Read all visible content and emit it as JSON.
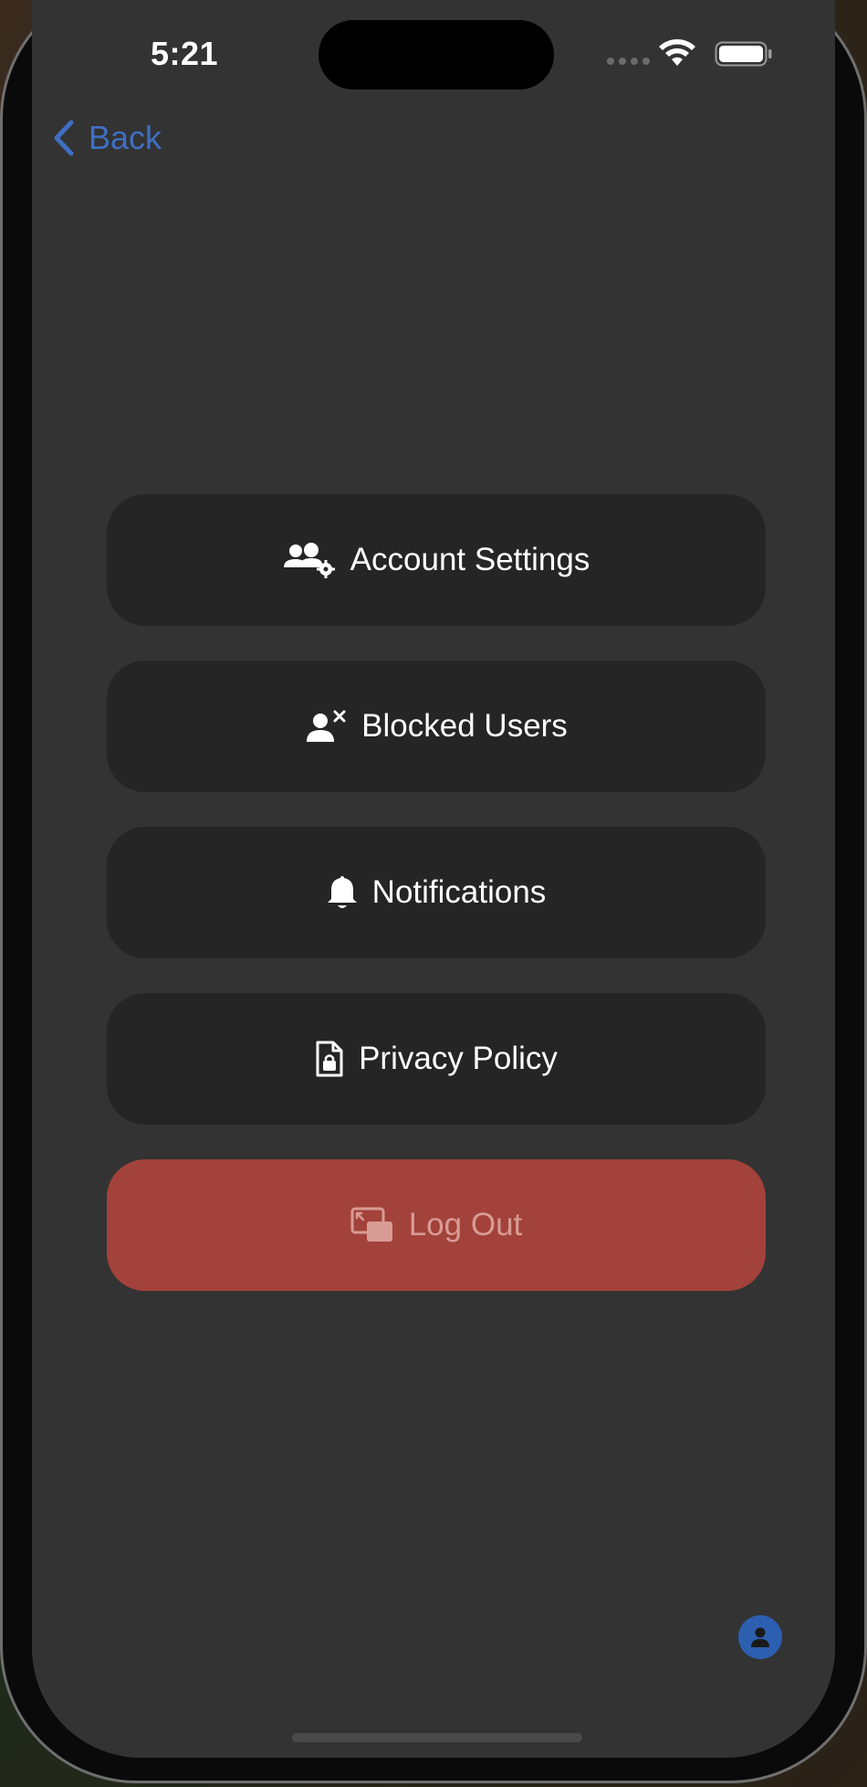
{
  "status_bar": {
    "time": "5:21",
    "icons": [
      "signal-icon",
      "wifi-icon",
      "battery-icon"
    ]
  },
  "nav": {
    "back_label": "Back",
    "back_icon": "chevron-left-icon"
  },
  "menu": {
    "items": [
      {
        "label": "Account Settings",
        "icon": "users-gear-icon"
      },
      {
        "label": "Blocked Users",
        "icon": "user-x-icon"
      },
      {
        "label": "Notifications",
        "icon": "bell-icon"
      },
      {
        "label": "Privacy Policy",
        "icon": "document-lock-icon"
      },
      {
        "label": "Log Out",
        "icon": "logout-screens-icon"
      }
    ]
  },
  "floating": {
    "profile_icon": "profile-icon"
  },
  "colors": {
    "background": "#333333",
    "button_bg": "#252525",
    "logout_bg": "#a3423a",
    "logout_text": "#d79c95",
    "accent": "#3e6fc2"
  }
}
